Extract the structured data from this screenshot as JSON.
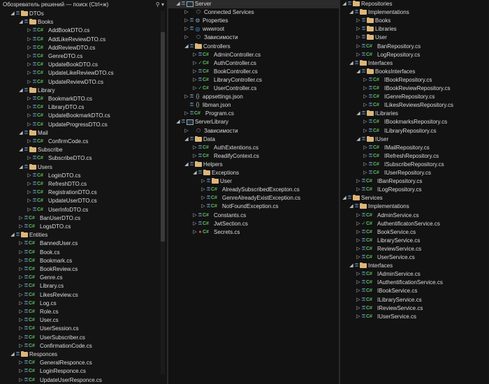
{
  "panel1": {
    "title": "Обозреватель решений — поиск (Ctrl+ж)",
    "search_icon": "search-icon",
    "rows": [
      {
        "d": 0,
        "t": "folder",
        "a": "open",
        "l": "DTOs"
      },
      {
        "d": 1,
        "t": "folder",
        "a": "open",
        "l": "Books"
      },
      {
        "d": 2,
        "t": "cs",
        "a": "closed",
        "l": "AddBookDTO.cs"
      },
      {
        "d": 2,
        "t": "cs",
        "a": "closed",
        "l": "AddLikeReviewDTO.cs"
      },
      {
        "d": 2,
        "t": "cs",
        "a": "closed",
        "l": "AddReviewDTO.cs"
      },
      {
        "d": 2,
        "t": "cs",
        "a": "closed",
        "l": "GenreDTO.cs"
      },
      {
        "d": 2,
        "t": "cs",
        "a": "closed",
        "l": "UpdateBookDTO.cs"
      },
      {
        "d": 2,
        "t": "cs",
        "a": "closed",
        "l": "UpdateLikeReviewDTO.cs"
      },
      {
        "d": 2,
        "t": "cs",
        "a": "closed",
        "l": "UpdateReviewDTO.cs"
      },
      {
        "d": 1,
        "t": "folder",
        "a": "open",
        "l": "Library"
      },
      {
        "d": 2,
        "t": "cs",
        "a": "closed",
        "l": "BookmarkDTO.cs"
      },
      {
        "d": 2,
        "t": "cs",
        "a": "closed",
        "l": "LibraryDTO.cs"
      },
      {
        "d": 2,
        "t": "cs",
        "a": "closed",
        "l": "UpdateBookmarkDTO.cs"
      },
      {
        "d": 2,
        "t": "cs",
        "a": "closed",
        "l": "UpdateProgressDTO.cs"
      },
      {
        "d": 1,
        "t": "folder",
        "a": "open",
        "l": "Mail"
      },
      {
        "d": 2,
        "t": "cs",
        "a": "closed",
        "l": "ConfirmCode.cs"
      },
      {
        "d": 1,
        "t": "folder",
        "a": "open",
        "l": "Subscribe"
      },
      {
        "d": 2,
        "t": "cs",
        "a": "closed",
        "l": "SubscribeDTO.cs"
      },
      {
        "d": 1,
        "t": "folder",
        "a": "open",
        "l": "Users"
      },
      {
        "d": 2,
        "t": "cs",
        "a": "closed",
        "l": "LoginDTO.cs"
      },
      {
        "d": 2,
        "t": "cs",
        "a": "closed",
        "l": "RefreshDTO.cs"
      },
      {
        "d": 2,
        "t": "cs",
        "a": "closed",
        "l": "RegistrationDTO.cs"
      },
      {
        "d": 2,
        "t": "cs",
        "a": "closed",
        "l": "UpdateUserDTO.cs"
      },
      {
        "d": 2,
        "t": "cs",
        "a": "closed",
        "l": "UserInfoDTO.cs"
      },
      {
        "d": 1,
        "t": "cs",
        "a": "closed",
        "l": "BanUserDTO.cs"
      },
      {
        "d": 1,
        "t": "cs",
        "a": "closed",
        "l": "LogsDTO.cs"
      },
      {
        "d": 0,
        "t": "folder",
        "a": "open",
        "l": "Entities"
      },
      {
        "d": 1,
        "t": "cs",
        "a": "closed",
        "l": "BannedUser.cs"
      },
      {
        "d": 1,
        "t": "cs",
        "a": "closed",
        "l": "Book.cs"
      },
      {
        "d": 1,
        "t": "cs",
        "a": "closed",
        "l": "Bookmark.cs"
      },
      {
        "d": 1,
        "t": "cs",
        "a": "closed",
        "l": "BookReview.cs"
      },
      {
        "d": 1,
        "t": "cs",
        "a": "closed",
        "l": "Genre.cs"
      },
      {
        "d": 1,
        "t": "cs",
        "a": "closed",
        "l": "Library.cs"
      },
      {
        "d": 1,
        "t": "cs",
        "a": "closed",
        "l": "LikesReview.cs"
      },
      {
        "d": 1,
        "t": "cs",
        "a": "closed",
        "l": "Log.cs"
      },
      {
        "d": 1,
        "t": "cs",
        "a": "closed",
        "l": "Role.cs"
      },
      {
        "d": 1,
        "t": "cs",
        "a": "closed",
        "l": "User.cs"
      },
      {
        "d": 1,
        "t": "cs",
        "a": "closed",
        "l": "UserSession.cs"
      },
      {
        "d": 1,
        "t": "cs",
        "a": "closed",
        "l": "UserSubscriber.cs"
      },
      {
        "d": 1,
        "t": "cs",
        "a": "closed",
        "l": "ConfirmationCode.cs"
      },
      {
        "d": 0,
        "t": "folder",
        "a": "open",
        "l": "Responces"
      },
      {
        "d": 1,
        "t": "cs",
        "a": "closed",
        "l": "GeneralResponce.cs"
      },
      {
        "d": 1,
        "t": "cs",
        "a": "closed",
        "l": "LoginResponce.cs"
      },
      {
        "d": 1,
        "t": "cs",
        "a": "closed",
        "l": "UpdateUserResponce.cs"
      }
    ]
  },
  "panel2": {
    "rows": [
      {
        "d": 0,
        "t": "proj",
        "a": "open",
        "l": "Server",
        "hl": true
      },
      {
        "d": 1,
        "t": "dep",
        "a": "closed",
        "l": "Connected Services",
        "nolock": true
      },
      {
        "d": 1,
        "t": "gear",
        "a": "closed",
        "l": "Properties"
      },
      {
        "d": 1,
        "t": "globe",
        "a": "closed",
        "l": "wwwroot"
      },
      {
        "d": 1,
        "t": "dep",
        "a": "closed",
        "l": "Зависимости",
        "nolock": true
      },
      {
        "d": 1,
        "t": "folder",
        "a": "open",
        "l": "Controllers"
      },
      {
        "d": 2,
        "t": "cs",
        "a": "closed",
        "l": "AdminController.cs"
      },
      {
        "d": 2,
        "t": "cs",
        "a": "closed",
        "l": "AuthController.cs",
        "mark": "chk"
      },
      {
        "d": 2,
        "t": "cs",
        "a": "closed",
        "l": "BookController.cs"
      },
      {
        "d": 2,
        "t": "cs",
        "a": "closed",
        "l": "LibraryController.cs"
      },
      {
        "d": 2,
        "t": "cs",
        "a": "closed",
        "l": "UserController.cs",
        "mark": "chk"
      },
      {
        "d": 1,
        "t": "json",
        "a": "closed",
        "l": "appsettings.json"
      },
      {
        "d": 1,
        "t": "json",
        "a": "none",
        "l": "libman.json"
      },
      {
        "d": 1,
        "t": "cs",
        "a": "closed",
        "l": "Program.cs"
      },
      {
        "d": 0,
        "t": "proj",
        "a": "open",
        "l": "ServerLibrary"
      },
      {
        "d": 1,
        "t": "dep",
        "a": "closed",
        "l": "Зависимости",
        "nolock": true
      },
      {
        "d": 1,
        "t": "folder",
        "a": "open",
        "l": "Data"
      },
      {
        "d": 2,
        "t": "cs",
        "a": "closed",
        "l": "AuthExtentions.cs"
      },
      {
        "d": 2,
        "t": "cs",
        "a": "closed",
        "l": "ReadifyContext.cs"
      },
      {
        "d": 1,
        "t": "folder",
        "a": "open",
        "l": "Helpers"
      },
      {
        "d": 2,
        "t": "folder",
        "a": "open",
        "l": "Exceptions"
      },
      {
        "d": 3,
        "t": "folder",
        "a": "closed",
        "l": "User"
      },
      {
        "d": 3,
        "t": "cs",
        "a": "closed",
        "l": "AlreadySubscribedExcepton.cs"
      },
      {
        "d": 3,
        "t": "cs",
        "a": "closed",
        "l": "GenreAlreadyExistException.cs"
      },
      {
        "d": 3,
        "t": "cs",
        "a": "closed",
        "l": "NotFoundException.cs"
      },
      {
        "d": 2,
        "t": "cs",
        "a": "closed",
        "l": "Constants.cs"
      },
      {
        "d": 2,
        "t": "cs",
        "a": "closed",
        "l": "JwtSection.cs"
      },
      {
        "d": 2,
        "t": "cs",
        "a": "closed",
        "l": "Secrets.cs",
        "mark": "red"
      }
    ]
  },
  "panel3": {
    "rows": [
      {
        "d": 0,
        "t": "folder",
        "a": "open",
        "l": "Repositories"
      },
      {
        "d": 1,
        "t": "folder",
        "a": "open",
        "l": "Implementations"
      },
      {
        "d": 2,
        "t": "folder",
        "a": "closed",
        "l": "Books"
      },
      {
        "d": 2,
        "t": "folder",
        "a": "closed",
        "l": "Libraries"
      },
      {
        "d": 2,
        "t": "folder",
        "a": "closed",
        "l": "User"
      },
      {
        "d": 2,
        "t": "cs",
        "a": "closed",
        "l": "BanRepository.cs"
      },
      {
        "d": 2,
        "t": "cs",
        "a": "closed",
        "l": "LogRepository.cs"
      },
      {
        "d": 1,
        "t": "folder",
        "a": "open",
        "l": "Interfaces"
      },
      {
        "d": 2,
        "t": "folder",
        "a": "open",
        "l": "BooksInterfaces"
      },
      {
        "d": 3,
        "t": "cs",
        "a": "closed",
        "l": "IBookRepository.cs"
      },
      {
        "d": 3,
        "t": "cs",
        "a": "closed",
        "l": "IBookReviewRepository.cs"
      },
      {
        "d": 3,
        "t": "cs",
        "a": "closed",
        "l": "IGenreRepository.cs"
      },
      {
        "d": 3,
        "t": "cs",
        "a": "closed",
        "l": "ILikesReviewsRepository.cs"
      },
      {
        "d": 2,
        "t": "folder",
        "a": "open",
        "l": "ILibraries"
      },
      {
        "d": 3,
        "t": "cs",
        "a": "closed",
        "l": "IBookmarksRepository.cs"
      },
      {
        "d": 3,
        "t": "cs",
        "a": "closed",
        "l": "ILibraryRepository.cs"
      },
      {
        "d": 2,
        "t": "folder",
        "a": "open",
        "l": "IUser"
      },
      {
        "d": 3,
        "t": "cs",
        "a": "closed",
        "l": "IMailRepository.cs"
      },
      {
        "d": 3,
        "t": "cs",
        "a": "closed",
        "l": "IRefreshRepository.cs"
      },
      {
        "d": 3,
        "t": "cs",
        "a": "closed",
        "l": "ISubscribeRepository.cs"
      },
      {
        "d": 3,
        "t": "cs",
        "a": "closed",
        "l": "IUserRepository.cs"
      },
      {
        "d": 2,
        "t": "cs",
        "a": "closed",
        "l": "IBanRepository.cs"
      },
      {
        "d": 2,
        "t": "cs",
        "a": "closed",
        "l": "ILogRepository.cs"
      },
      {
        "d": 0,
        "t": "folder",
        "a": "open",
        "l": "Services"
      },
      {
        "d": 1,
        "t": "folder",
        "a": "open",
        "l": "Implementations"
      },
      {
        "d": 2,
        "t": "cs",
        "a": "closed",
        "l": "AdminService.cs"
      },
      {
        "d": 2,
        "t": "cs",
        "a": "closed",
        "l": "AuthentificatonService.cs",
        "mark": "chk"
      },
      {
        "d": 2,
        "t": "cs",
        "a": "closed",
        "l": "BookService.cs"
      },
      {
        "d": 2,
        "t": "cs",
        "a": "closed",
        "l": "LibraryService.cs"
      },
      {
        "d": 2,
        "t": "cs",
        "a": "closed",
        "l": "ReviewService.cs"
      },
      {
        "d": 2,
        "t": "cs",
        "a": "closed",
        "l": "UserService.cs"
      },
      {
        "d": 1,
        "t": "folder",
        "a": "open",
        "l": "Interfaces"
      },
      {
        "d": 2,
        "t": "cs",
        "a": "closed",
        "l": "IAdminService.cs"
      },
      {
        "d": 2,
        "t": "cs",
        "a": "closed",
        "l": "IAuthentificationService.cs"
      },
      {
        "d": 2,
        "t": "cs",
        "a": "closed",
        "l": "IBookService.cs"
      },
      {
        "d": 2,
        "t": "cs",
        "a": "closed",
        "l": "ILibraryService.cs"
      },
      {
        "d": 2,
        "t": "cs",
        "a": "closed",
        "l": "IReviewService.cs"
      },
      {
        "d": 2,
        "t": "cs",
        "a": "closed",
        "l": "IUserService.cs"
      }
    ]
  }
}
